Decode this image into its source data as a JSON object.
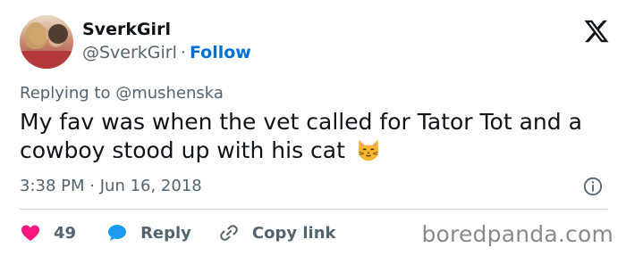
{
  "user": {
    "display_name": "SverkGirl",
    "handle": "@SverkGirl",
    "separator": "·",
    "follow_label": "Follow"
  },
  "tweet": {
    "replying_prefix": "Replying to",
    "replying_to": "@mushenska",
    "text": "My fav was when the vet called for Tator Tot and a cowboy stood up with his cat",
    "emoji": "cat-face-emoji",
    "time": "3:38 PM",
    "date": "Jun 16, 2018",
    "meta_separator": "·"
  },
  "actions": {
    "like_count": "49",
    "reply_label": "Reply",
    "copy_label": "Copy link"
  },
  "icons": {
    "logo": "x-logo-icon",
    "info": "info-icon",
    "like": "heart-icon",
    "reply": "speech-bubble-icon",
    "copy": "link-icon"
  },
  "colors": {
    "follow": "#006fd6",
    "like": "#f91880",
    "reply": "#1d9bf0",
    "muted": "#536471"
  },
  "watermark": "boredpanda.com"
}
